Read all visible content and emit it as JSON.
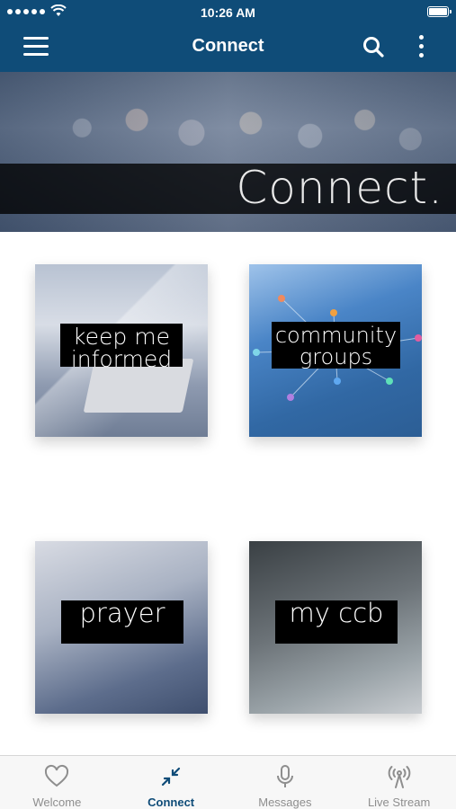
{
  "status_bar": {
    "time": "10:26 AM"
  },
  "nav": {
    "title": "Connect"
  },
  "hero": {
    "title": "Connect."
  },
  "tiles": {
    "keep_line1": "keep me",
    "keep_line2": "informed",
    "community_line1": "community",
    "community_line2": "groups",
    "prayer": "prayer",
    "ccb": "my ccb"
  },
  "tabs": [
    {
      "label": "Welcome",
      "icon": "heart-icon"
    },
    {
      "label": "Connect",
      "icon": "arrows-in-icon"
    },
    {
      "label": "Messages",
      "icon": "microphone-icon"
    },
    {
      "label": "Live Stream",
      "icon": "broadcast-icon"
    }
  ],
  "colors": {
    "nav": "#0f4c78",
    "tab_active": "#0f4c78",
    "tab_inactive": "#8e8e8e"
  }
}
